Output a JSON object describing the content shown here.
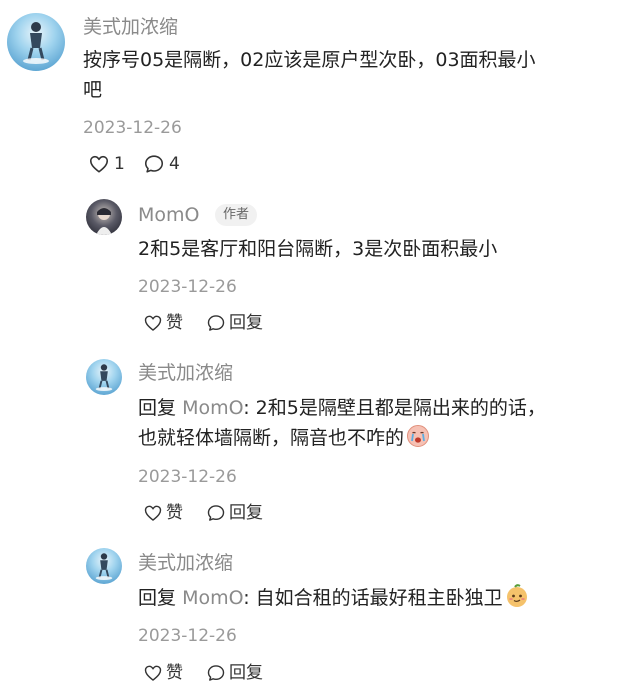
{
  "root_comment": {
    "username": "美式加浓缩",
    "text_line1": "按序号05是隔断，02应该是原户型次卧，03面积最小",
    "text_line2": "吧",
    "date": "2023-12-26",
    "like_count": "1",
    "reply_count": "4"
  },
  "replies": [
    {
      "username": "MomO",
      "badge": "作者",
      "text": "2和5是客厅和阳台隔断，3是次卧面积最小",
      "date": "2023-12-26",
      "like_label": "赞",
      "reply_label": "回复"
    },
    {
      "username": "美式加浓缩",
      "reply_prefix": "回复",
      "mention": "MomO",
      "text_line1": ": 2和5是隔壁且都是隔出来的的话，",
      "text_line2": "也就轻体墙隔断，隔音也不咋的",
      "emoji": "crying-face-emoji",
      "date": "2023-12-26",
      "like_label": "赞",
      "reply_label": "回复"
    },
    {
      "username": "美式加浓缩",
      "reply_prefix": "回复",
      "mention": "MomO",
      "text": ": 自如合租的话最好租主卧独卫",
      "emoji": "smirk-face-emoji",
      "date": "2023-12-26",
      "like_label": "赞",
      "reply_label": "回复"
    }
  ]
}
